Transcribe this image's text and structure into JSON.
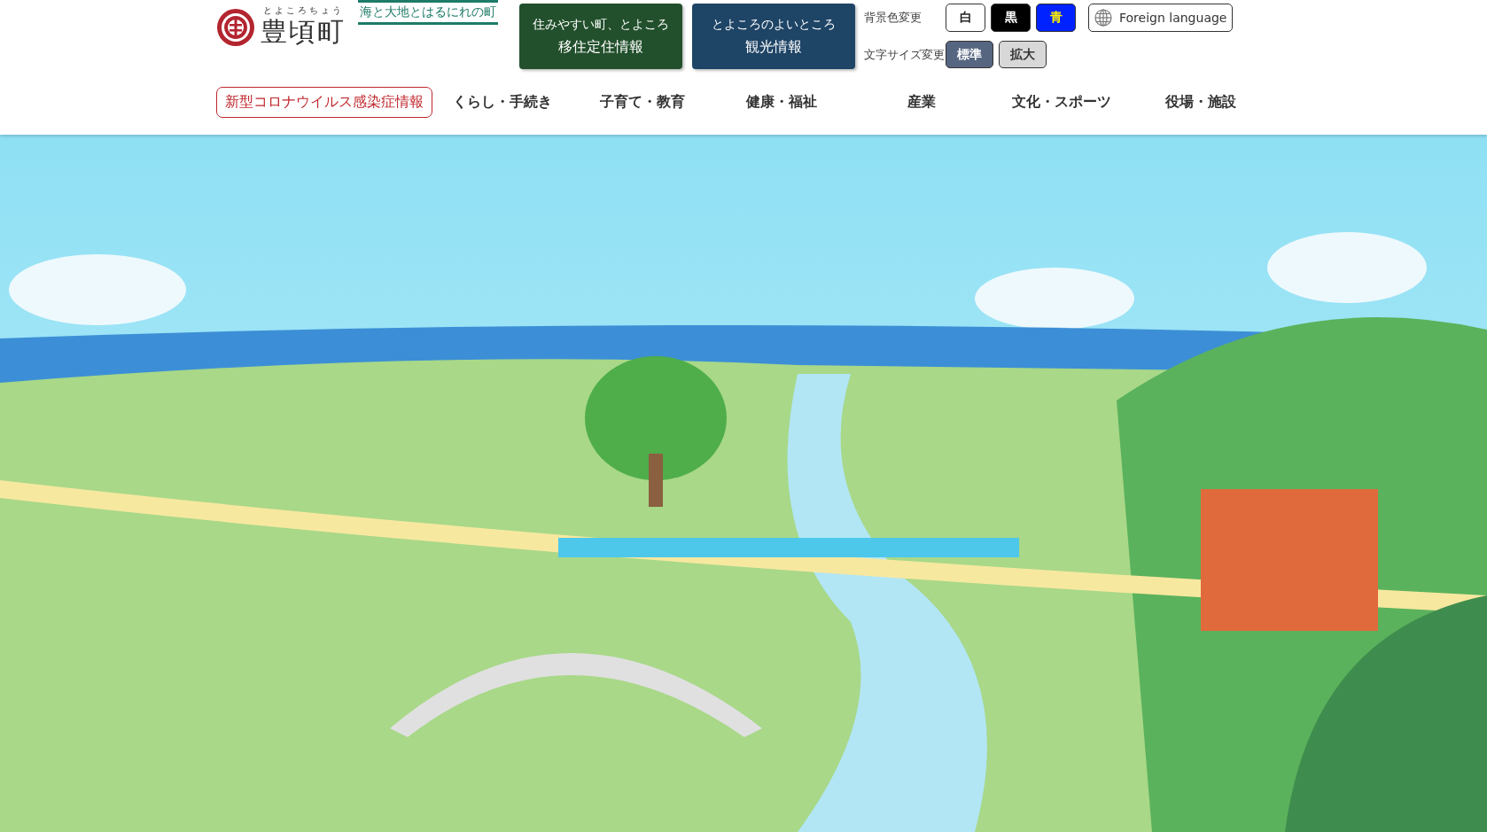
{
  "logo": {
    "reading": "とよころちょう",
    "name": "豊頃町",
    "tagline": "海と大地とはるにれの町"
  },
  "feature_buttons": [
    {
      "kind": "green",
      "line1": "住みやすい町、とよころ",
      "line2": "移住定住情報"
    },
    {
      "kind": "blue",
      "line1": "とよころのよいところ",
      "line2": "観光情報"
    }
  ],
  "background_color": {
    "label": "背景色変更",
    "options": [
      {
        "kind": "white",
        "label": "白"
      },
      {
        "kind": "black",
        "label": "黒"
      },
      {
        "kind": "blue",
        "label": "青"
      }
    ]
  },
  "foreign_language": {
    "label": "Foreign language"
  },
  "text_size": {
    "label": "文字サイズ変更",
    "options": [
      {
        "label": "標準",
        "selected": true
      },
      {
        "label": "拡大",
        "selected": false
      }
    ]
  },
  "nav": {
    "notice": "新型コロナウイルス感染症情報",
    "items": [
      "くらし・手続き",
      "子育て・教育",
      "健康・福祉",
      "産業",
      "文化・スポーツ",
      "役場・施設"
    ]
  }
}
